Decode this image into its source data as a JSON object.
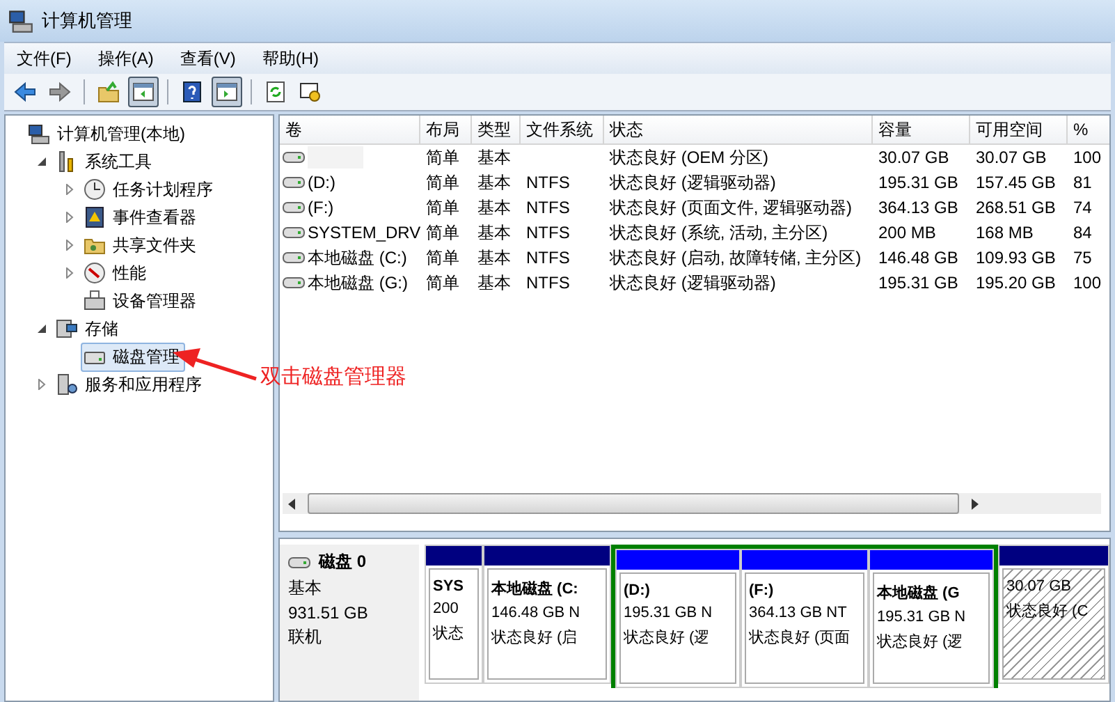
{
  "window": {
    "title": "计算机管理"
  },
  "menu": [
    "文件(F)",
    "操作(A)",
    "查看(V)",
    "帮助(H)"
  ],
  "toolbar": [
    {
      "kind": "back",
      "pressed": false
    },
    {
      "kind": "forward",
      "pressed": false
    },
    {
      "kind": "sep"
    },
    {
      "kind": "up",
      "pressed": false
    },
    {
      "kind": "tree",
      "pressed": true
    },
    {
      "kind": "sep"
    },
    {
      "kind": "help",
      "pressed": false
    },
    {
      "kind": "pane",
      "pressed": true
    },
    {
      "kind": "sep"
    },
    {
      "kind": "refresh",
      "pressed": false
    },
    {
      "kind": "props",
      "pressed": false
    }
  ],
  "tree": [
    {
      "label": "计算机管理(本地)",
      "selected": false,
      "children": [
        {
          "label": "系统工具",
          "selected": false,
          "expanded": true,
          "children": [
            {
              "label": "任务计划程序",
              "selected": false,
              "expanded": false
            },
            {
              "label": "事件查看器",
              "selected": false,
              "expanded": false
            },
            {
              "label": "共享文件夹",
              "selected": false,
              "expanded": false
            },
            {
              "label": "性能",
              "selected": false,
              "expanded": false
            },
            {
              "label": "设备管理器",
              "selected": false
            }
          ]
        },
        {
          "label": "存储",
          "selected": false,
          "expanded": true,
          "children": [
            {
              "label": "磁盘管理",
              "selected": true
            }
          ]
        },
        {
          "label": "服务和应用程序",
          "selected": false,
          "expanded": false
        }
      ]
    }
  ],
  "annotation": {
    "text": "双击磁盘管理器"
  },
  "table": {
    "columns": [
      "卷",
      "布局",
      "类型",
      "文件系统",
      "状态",
      "容量",
      "可用空间",
      "%"
    ],
    "rows": [
      [
        "",
        "简单",
        "基本",
        "",
        "状态良好 (OEM 分区)",
        "30.07 GB",
        "30.07 GB",
        "100"
      ],
      [
        " (D:)",
        "简单",
        "基本",
        "NTFS",
        "状态良好 (逻辑驱动器)",
        "195.31 GB",
        "157.45 GB",
        "81"
      ],
      [
        " (F:)",
        "简单",
        "基本",
        "NTFS",
        "状态良好 (页面文件, 逻辑驱动器)",
        "364.13 GB",
        "268.51 GB",
        "74"
      ],
      [
        "SYSTEM_DRV",
        "简单",
        "基本",
        "NTFS",
        "状态良好 (系统, 活动, 主分区)",
        "200 MB",
        "168 MB",
        "84"
      ],
      [
        "本地磁盘 (C:)",
        "简单",
        "基本",
        "NTFS",
        "状态良好 (启动, 故障转储, 主分区)",
        "146.48 GB",
        "109.93 GB",
        "75"
      ],
      [
        "本地磁盘 (G:)",
        "简单",
        "基本",
        "NTFS",
        "状态良好 (逻辑驱动器)",
        "195.31 GB",
        "195.20 GB",
        "100"
      ]
    ]
  },
  "disk": {
    "name": "磁盘 0",
    "type": "基本",
    "size": "931.51 GB",
    "status": "联机",
    "partitions": [
      {
        "kind": "primary",
        "selected": false,
        "lines": [
          "SYS",
          "200",
          "状态"
        ]
      },
      {
        "kind": "primary",
        "selected": false,
        "lines": [
          "本地磁盘 (C:",
          "146.48 GB N",
          "状态良好 (启"
        ]
      },
      {
        "kind": "extended",
        "selected": false,
        "children": [
          {
            "kind": "logical",
            "selected": false,
            "lines": [
              "(D:)",
              "195.31 GB N",
              "状态良好 (逻"
            ]
          },
          {
            "kind": "logical",
            "selected": false,
            "lines": [
              "(F:)",
              "364.13 GB NT",
              "状态良好 (页面"
            ]
          },
          {
            "kind": "logical",
            "selected": false,
            "lines": [
              "本地磁盘 (G",
              "195.31 GB N",
              "状态良好 (逻"
            ]
          }
        ]
      },
      {
        "kind": "primary",
        "selected": true,
        "lines": [
          "30.07 GB",
          "状态良好 (C"
        ]
      }
    ]
  }
}
